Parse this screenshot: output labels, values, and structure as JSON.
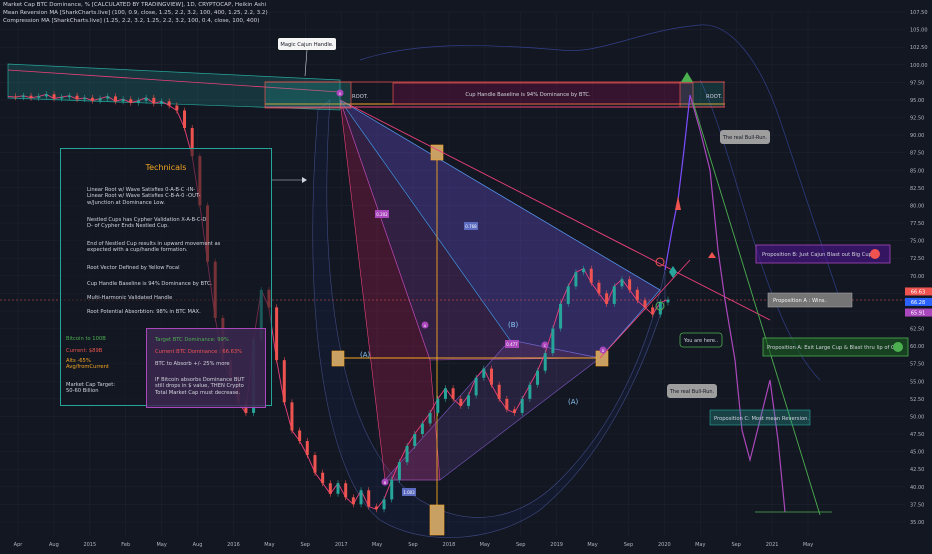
{
  "header": {
    "line1": "Market Cap BTC Dominance, % [CALCULATED BY TRADINGVIEW], 1D, CRYPTOCAP, Heikin Ashi",
    "line2": "Mean Reversion MA [SharkCharts.live] (100, 0.9, close, 1.25, 2.2, 3.2, 100, 400, 1.25, 2.2, 3.2)",
    "line3": "Compression MA [SharkCharts.live] (1.25, 2.2, 3.2, 1.25, 2.2, 3.2, 100, 0.4, close, 100, 400)"
  },
  "technicals": {
    "title": "Technicals",
    "lines": [
      "Linear Root w/ Wave Satisfies 0-A-B-C -IN-\nLinear Root w/ Wave Satisfies C-B-A-0 -OUT-\nw/Junction at Dominance Low.",
      "Nestled Cups has Cypher Validation X-A-B-C-D\nD- of Cypher Ends Nestled Cup.",
      "End of Nestled Cup results in upward movement as\nexpected with a cup/handle formation.",
      "Root Vector Defined by Yellow Focal",
      "Cup Handle Baseline is 94% Dominance by BTC.",
      "Multi-Harmonic Validated Handle",
      "Root Potential Absorbtion: 98% in BTC MAX."
    ],
    "side": {
      "bitcoin_to": "Bitcoin to 100B",
      "current": "Current: $89B",
      "alts": "Alts -65%\nAvg/fromCurrent",
      "target": "Market Cap Target:\n50-60 Billion"
    },
    "inner": {
      "target_dom": "Target BTC Dominance: 99%",
      "current_dom": "Current BTC Dominance : 66.63%",
      "absorb": "BTC to Absorb +/- 25% more",
      "if_text": "IF Bitcoin absorbs Dominance BUT\nstill drops in $ value, THEN Crypto\nTotal Market Cap must decrease."
    },
    "colors": {
      "green": "#4caf50",
      "red": "#ef5350",
      "gold": "#f5a623",
      "text": "#d1d4dc"
    }
  },
  "annotations": {
    "magic_cajun": "Magic Cajun Handle.",
    "root_left": "ROOT.",
    "root_right": "ROOT.",
    "cup_baseline": "Cup Handle Baseline is 94% Dominance by BTC.",
    "real_bull_top": "The real Bull-Run.",
    "real_bull_bottom": "The real Bull-Run.",
    "you_are_here": "You are here..",
    "prop_b": "Proposition B: Just Cajun Blast out Big Cup.",
    "prop_a_wins": "Proposition A : Wins.",
    "prop_a": "Proposition A: Exit Large Cup & Blast thru lip of Cup.",
    "prop_c": "Proposition C: Most mean Reversion.",
    "wave_A1": "(A)",
    "wave_B": "(B)",
    "wave_A2": "(A)",
    "fib_1": "0.202",
    "fib_2": "0.768",
    "fib_3": "0.477",
    "fib_4": "1.003",
    "pt_x": "X",
    "pt_a": "A",
    "pt_b": "B",
    "pt_c": "C",
    "pt_d": "D"
  },
  "chart_data": {
    "type": "line",
    "title": "",
    "xlabel": "",
    "ylabel": "",
    "ylim": [
      33,
      107.5
    ],
    "y_ticks": [
      35,
      37.5,
      40,
      42.5,
      45,
      47.5,
      50,
      52.5,
      55,
      57.5,
      60,
      62.5,
      65,
      67.5,
      70,
      72.5,
      75,
      77.5,
      80,
      82.5,
      85,
      87.5,
      90,
      92.5,
      95,
      97.5,
      100,
      102.5,
      105,
      107.5
    ],
    "x_ticks": [
      "Apr",
      "Aug",
      "2015",
      "Feb",
      "May",
      "Aug",
      "2016",
      "May",
      "Sep",
      "2017",
      "May",
      "Sep",
      "2018",
      "May",
      "Sep",
      "2019",
      "May",
      "Sep",
      "2020",
      "May",
      "Sep",
      "2021",
      "May"
    ],
    "price_labels": [
      {
        "text": "66.63",
        "value": 66.63,
        "color": "#ef5350"
      },
      {
        "text": "66.28",
        "value": 66.28,
        "color": "#2962ff"
      },
      {
        "text": "65.91",
        "value": 65.91,
        "color": "#ab47bc"
      }
    ],
    "series": [
      {
        "values": [
          95.5,
          95.4,
          95.6,
          95.3,
          95.5,
          95.8,
          95.2,
          95.4,
          95.6,
          95.1,
          95.3,
          94.9,
          95.2,
          95.5,
          94.8,
          95.1,
          94.6,
          94.9,
          95.3,
          94.5,
          94.8,
          94.2,
          93.5,
          91.0,
          87.0,
          80.0,
          72.0,
          64.0,
          58.0,
          55.5,
          52.0,
          50.5,
          61.0,
          68.0,
          65.5,
          58.0,
          52.0,
          48.0,
          46.5,
          44.5,
          42.0,
          40.5,
          39.0,
          40.5,
          38.5,
          37.5,
          39.5,
          37.2,
          36.8,
          38.2,
          41.0,
          43.5,
          45.8,
          47.5,
          49.0,
          50.5,
          52.5,
          54.0,
          52.5,
          51.5,
          53.0,
          55.5,
          56.8,
          54.5,
          52.5,
          51.0,
          50.5,
          52.5,
          54.5,
          56.5,
          59.0,
          62.5,
          66.0,
          68.5,
          70.5,
          71.0,
          69.0,
          67.5,
          66.0,
          68.5,
          69.5,
          68.0,
          66.5,
          65.5,
          64.5,
          66.2,
          66.6
        ]
      }
    ]
  }
}
